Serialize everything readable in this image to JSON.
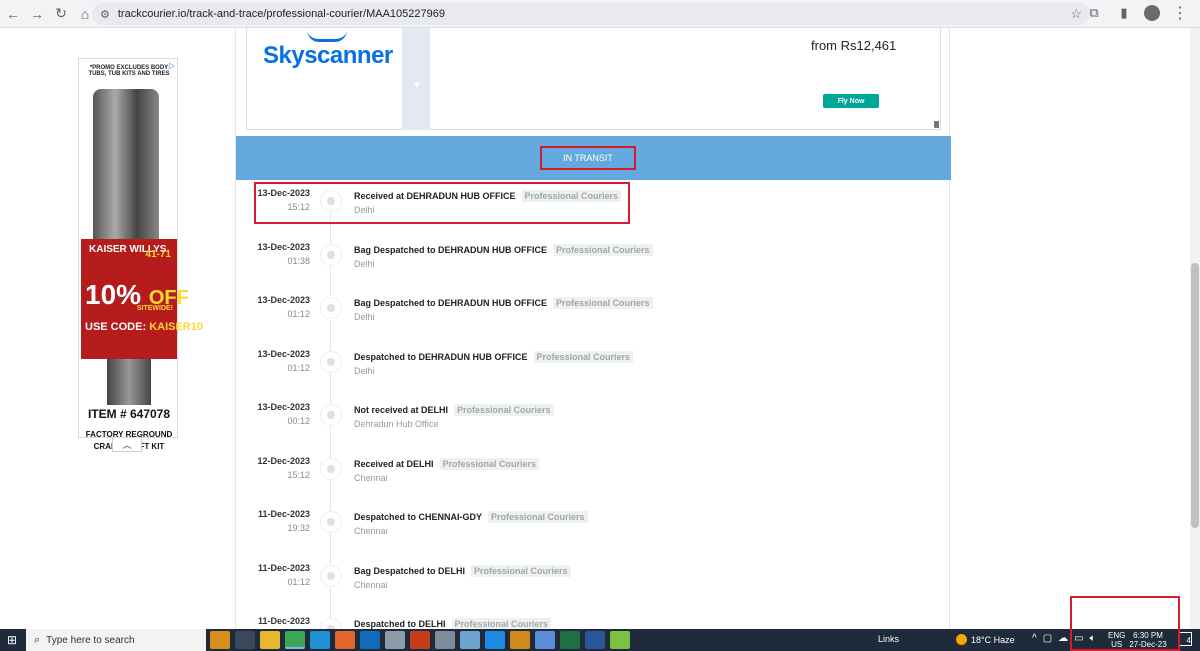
{
  "browser": {
    "url": "trackcourier.io/track-and-trace/professional-courier/MAA105227969"
  },
  "left_ad": {
    "promo": "*PROMO EXCLUDES BODY TUBS, TUB KITS AND TIRES",
    "brand": "KAISER WILLYS",
    "year": "41-71",
    "percent": "10%",
    "off": "OFF",
    "sitewide": "SITEWIDE!",
    "use_code": "USE CODE:",
    "code": "KAISER10",
    "item": "ITEM # 647078",
    "desc1": "FACTORY REGROUND",
    "desc2": "CRANKSHAFT KIT"
  },
  "top_ad": {
    "brand": "Skyscanner",
    "price": "from Rs12,461",
    "cta": "Fly Now"
  },
  "status": "IN TRANSIT",
  "events": [
    {
      "date": "13-Dec-2023",
      "time": "15:12",
      "title": "Received at DEHRADUN HUB OFFICE",
      "tag": "Professional Couriers",
      "location": "Delhi"
    },
    {
      "date": "13-Dec-2023",
      "time": "01:38",
      "title": "Bag Despatched to DEHRADUN HUB OFFICE",
      "tag": "Professional Couriers",
      "location": "Delhi"
    },
    {
      "date": "13-Dec-2023",
      "time": "01:12",
      "title": "Bag Despatched to DEHRADUN HUB OFFICE",
      "tag": "Professional Couriers",
      "location": "Delhi"
    },
    {
      "date": "13-Dec-2023",
      "time": "01:12",
      "title": "Despatched to DEHRADUN HUB OFFICE",
      "tag": "Professional Couriers",
      "location": "Delhi"
    },
    {
      "date": "13-Dec-2023",
      "time": "00:12",
      "title": "Not received at DELHI",
      "tag": "Professional Couriers",
      "location": "Dehradun Hub Office"
    },
    {
      "date": "12-Dec-2023",
      "time": "15:12",
      "title": "Received at DELHI",
      "tag": "Professional Couriers",
      "location": "Chennai"
    },
    {
      "date": "11-Dec-2023",
      "time": "19:32",
      "title": "Despatched to CHENNAI-GDY",
      "tag": "Professional Couriers",
      "location": "Chennai"
    },
    {
      "date": "11-Dec-2023",
      "time": "01:12",
      "title": "Bag Despatched to DELHI",
      "tag": "Professional Couriers",
      "location": "Chennai"
    },
    {
      "date": "11-Dec-2023",
      "time": "",
      "title": "Despatched to DELHI",
      "tag": "Professional Couriers",
      "location": ""
    }
  ],
  "taskbar": {
    "search_placeholder": "Type here to search",
    "links": "Links",
    "weather": "18°C  Haze",
    "lang1": "ENG",
    "lang2": "US",
    "time": "6:30 PM",
    "date": "27-Dec-23",
    "notifications": "4"
  }
}
